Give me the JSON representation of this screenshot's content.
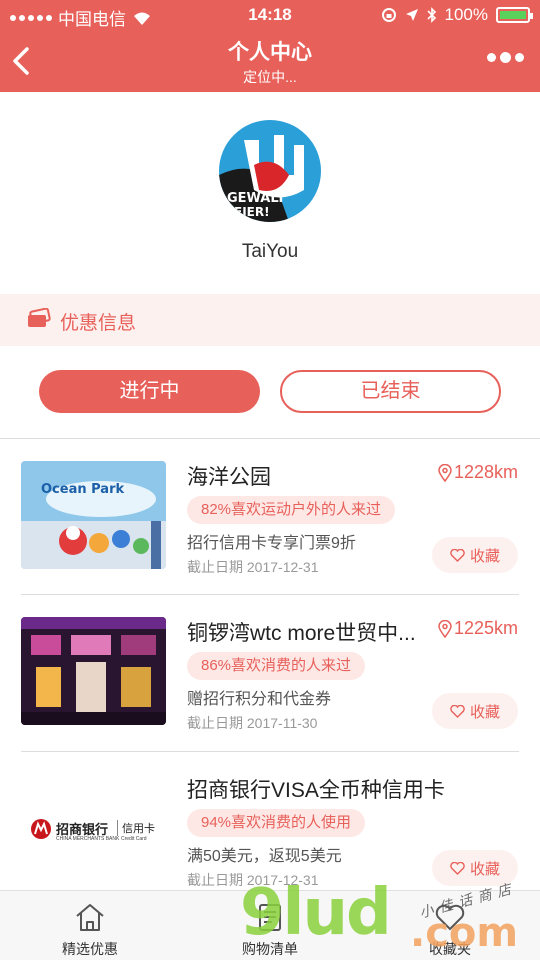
{
  "status": {
    "carrier": "中国电信",
    "time": "14:18",
    "battery": "100%"
  },
  "nav": {
    "title": "个人中心",
    "subtitle": "定位中..."
  },
  "profile": {
    "username": "TaiYou"
  },
  "coupon": {
    "label": "优惠信息"
  },
  "tabs": {
    "active": "进行中",
    "inactive": "已结束"
  },
  "items": [
    {
      "title": "海洋公园",
      "distance": "1228km",
      "tag": "82%喜欢运动户外的人来过",
      "desc": "招行信用卡专享门票9折",
      "date": "截止日期 2017-12-31",
      "fav": "收藏"
    },
    {
      "title": "铜锣湾wtc more世贸中...",
      "distance": "1225km",
      "tag": "86%喜欢消费的人来过",
      "desc": "赠招行积分和代金券",
      "date": "截止日期 2017-11-30",
      "fav": "收藏"
    },
    {
      "title": "招商银行VISA全币种信用卡",
      "distance": "",
      "tag": "94%喜欢消费的人使用",
      "desc": "满50美元，返现5美元",
      "date": "截止日期 2017-12-31",
      "fav": "收藏",
      "logo_text": "招商银行",
      "logo_sub": "信用卡",
      "logo_en": "CHINA MERCHANTS BANK",
      "logo_en_sub": "Credit Card"
    }
  ],
  "tabbar": [
    {
      "label": "精选优惠",
      "icon": "home-icon"
    },
    {
      "label": "购物清单",
      "icon": "list-icon"
    },
    {
      "label": "收藏夹",
      "icon": "heart-icon"
    }
  ],
  "watermark": {
    "brand": "9lud",
    "tld": ".com",
    "shop": "小佳话商店"
  },
  "colors": {
    "accent": "#e8605a",
    "tag_bg": "#fde8e6"
  }
}
